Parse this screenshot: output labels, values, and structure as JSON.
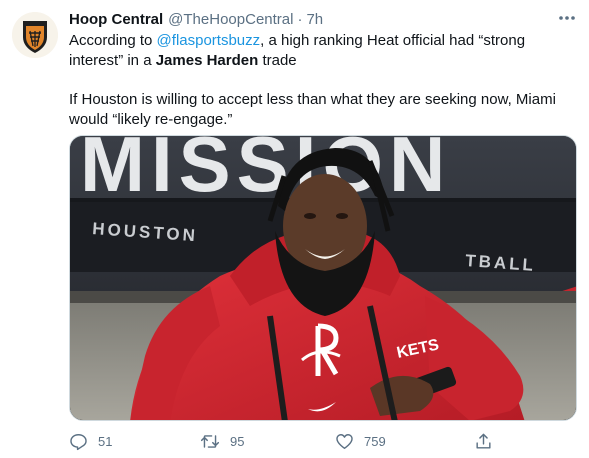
{
  "tweet": {
    "display_name": "Hoop Central",
    "handle": "@TheHoopCentral",
    "separator": "·",
    "time": "7h",
    "text_before_mention": "According to ",
    "mention": "@flasportsbuzz",
    "text_after_mention": ", a high ranking Heat official had “strong interest” in a ",
    "bold_name": "James Harden",
    "text_end": " trade",
    "paragraph2": "If Houston is willing to accept less than what they are seeking now, Miami would “likely re-engage.”",
    "photo": {
      "banner_text": "MISSION",
      "board_text": "HOUSTON",
      "board_text2": "TBALL",
      "jacket_text": "KETS"
    }
  },
  "actions": {
    "reply_count": "51",
    "retweet_count": "95",
    "like_count": "759"
  },
  "icons": {
    "avatar": "basketball-shield-logo",
    "more": "more-horizontal-icon",
    "reply": "reply-icon",
    "retweet": "retweet-icon",
    "like": "heart-icon",
    "share": "share-icon"
  },
  "colors": {
    "link": "#1b95e0",
    "secondary_text": "#5b7083",
    "jacket_red": "#d0232e",
    "logo_orange": "#e1852a"
  }
}
